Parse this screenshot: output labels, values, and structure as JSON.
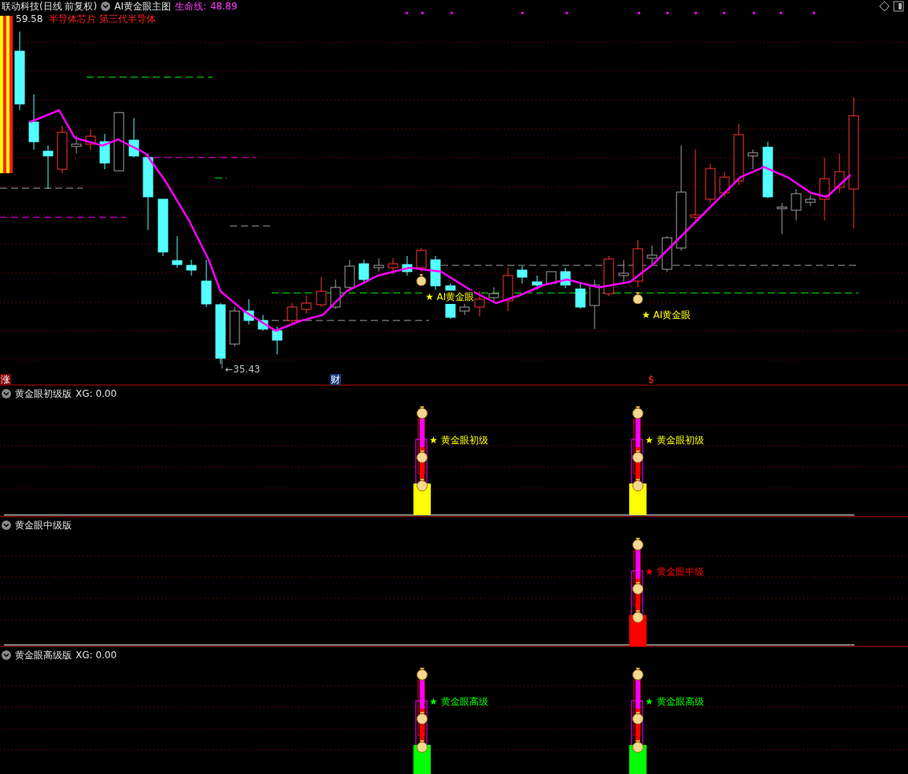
{
  "header": {
    "stock": "联动科技(日线 前复权)",
    "indicator": "AI黄金眼主图",
    "line_label": "生命线:",
    "line_value": "48.89"
  },
  "main": {
    "high_label": "59.58",
    "concepts": "半导体芯片 第三代半导体",
    "low_label": "←35.43",
    "badges": [
      {
        "text": "涨",
        "kind": "rise"
      },
      {
        "text": "财",
        "kind": "finance"
      },
      {
        "text": "$",
        "kind": "dollar"
      }
    ],
    "signals": [
      {
        "text": "★ AI黄金眼"
      },
      {
        "text": "★ AI黄金眼"
      }
    ]
  },
  "panels": [
    {
      "title": "黄金眼初级版",
      "reading": "XG: 0.00",
      "color": "#ffff00",
      "signals": [
        {
          "text": "★ 黄金眼初级",
          "kind": "first"
        },
        {
          "text": "★ 黄金眼初级",
          "kind": "second"
        }
      ]
    },
    {
      "title": "黄金眼中级版",
      "color": "#ff0000",
      "signals": [
        {
          "text": "★ 黄金眼中级",
          "kind": "second"
        }
      ]
    },
    {
      "title": "黄金眼高级版",
      "reading": "XG: 0.00",
      "color": "#00ff00",
      "signals": [
        {
          "text": "★ 黄金眼高级",
          "kind": "first"
        },
        {
          "text": "★ 黄金眼高级",
          "kind": "second"
        }
      ]
    }
  ]
}
